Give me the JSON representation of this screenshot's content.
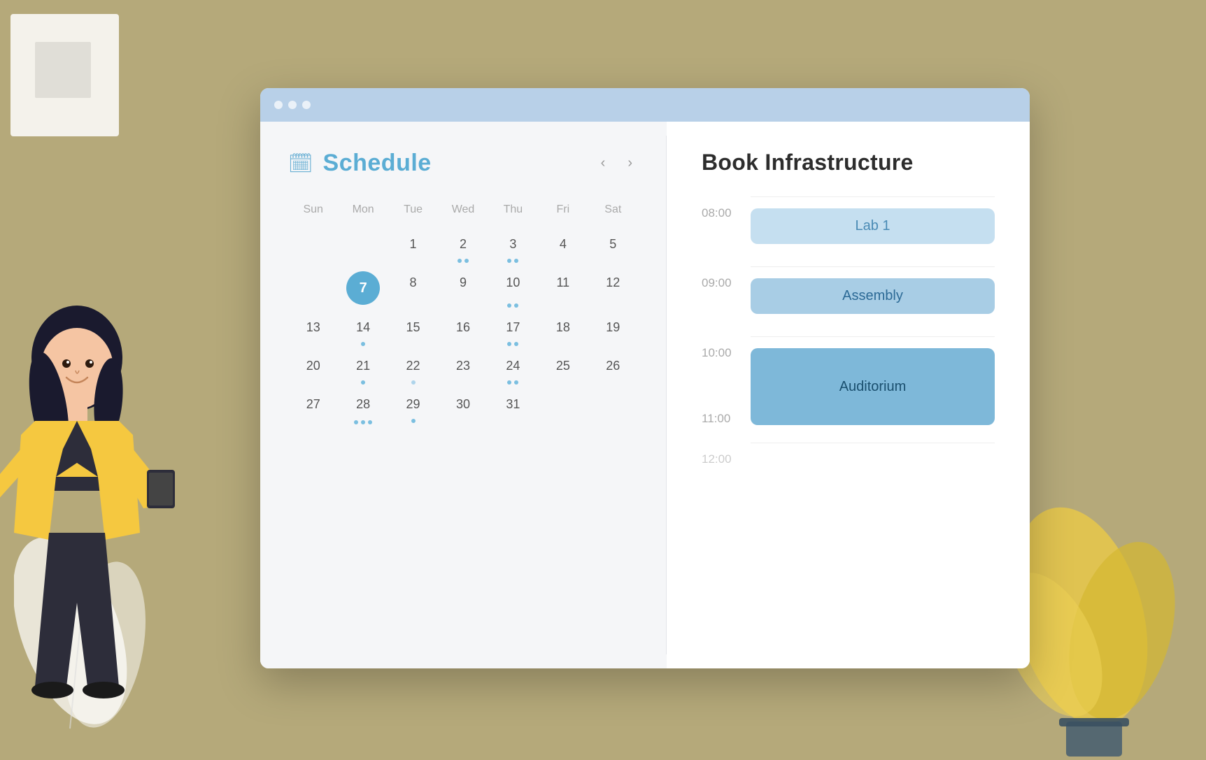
{
  "browser": {
    "dots": [
      "dot1",
      "dot2",
      "dot3"
    ]
  },
  "calendar": {
    "title": "Schedule",
    "icon": "📅",
    "day_names": [
      "Sun",
      "Mon",
      "Tue",
      "Wed",
      "Thu",
      "Fri",
      "Sat"
    ],
    "nav_prev": "‹",
    "nav_next": "›",
    "weeks": [
      [
        {
          "num": "",
          "dots": []
        },
        {
          "num": "",
          "dots": []
        },
        {
          "num": "1",
          "dots": []
        },
        {
          "num": "2",
          "dots": [
            "blue",
            "blue"
          ]
        },
        {
          "num": "3",
          "dots": [
            "blue",
            "blue"
          ]
        },
        {
          "num": "4",
          "dots": []
        },
        {
          "num": "5",
          "dots": []
        }
      ],
      [
        {
          "num": "",
          "dots": []
        },
        {
          "num": "7",
          "today": true,
          "dots": [
            "blue",
            "blue",
            "blue"
          ]
        },
        {
          "num": "8",
          "dots": []
        },
        {
          "num": "9",
          "dots": []
        },
        {
          "num": "10",
          "dots": [
            "blue",
            "blue"
          ]
        },
        {
          "num": "11",
          "dots": []
        },
        {
          "num": "12",
          "dots": []
        }
      ],
      [
        {
          "num": "13",
          "dots": []
        },
        {
          "num": "14",
          "dots": [
            "blue"
          ]
        },
        {
          "num": "15",
          "dots": []
        },
        {
          "num": "16",
          "dots": []
        },
        {
          "num": "17",
          "dots": [
            "blue",
            "blue"
          ]
        },
        {
          "num": "18",
          "dots": []
        },
        {
          "num": "19",
          "dots": []
        }
      ],
      [
        {
          "num": "20",
          "dots": []
        },
        {
          "num": "21",
          "dots": [
            "blue"
          ]
        },
        {
          "num": "22",
          "dots": [
            "light"
          ]
        },
        {
          "num": "23",
          "dots": []
        },
        {
          "num": "24",
          "dots": [
            "blue",
            "blue"
          ]
        },
        {
          "num": "25",
          "dots": []
        },
        {
          "num": "26",
          "dots": []
        }
      ],
      [
        {
          "num": "27",
          "dots": []
        },
        {
          "num": "28",
          "dots": []
        },
        {
          "num": "29",
          "dots": [
            "blue"
          ]
        },
        {
          "num": "30",
          "dots": []
        },
        {
          "num": "31",
          "dots": []
        },
        {
          "num": "",
          "dots": []
        },
        {
          "num": "",
          "dots": []
        }
      ]
    ]
  },
  "booking": {
    "title": "Book  Infrastructure",
    "time_slots": [
      {
        "time": "08:00",
        "label": "Lab  1",
        "style": "light"
      },
      {
        "time": "09:00",
        "label": "Assembly",
        "style": "medium"
      },
      {
        "time": "10:00",
        "label": "Auditorium",
        "style": "strong",
        "span": 2
      },
      {
        "time": "11:00",
        "label": "",
        "style": ""
      },
      {
        "time": "12:00",
        "label": "",
        "style": "faded"
      }
    ]
  }
}
